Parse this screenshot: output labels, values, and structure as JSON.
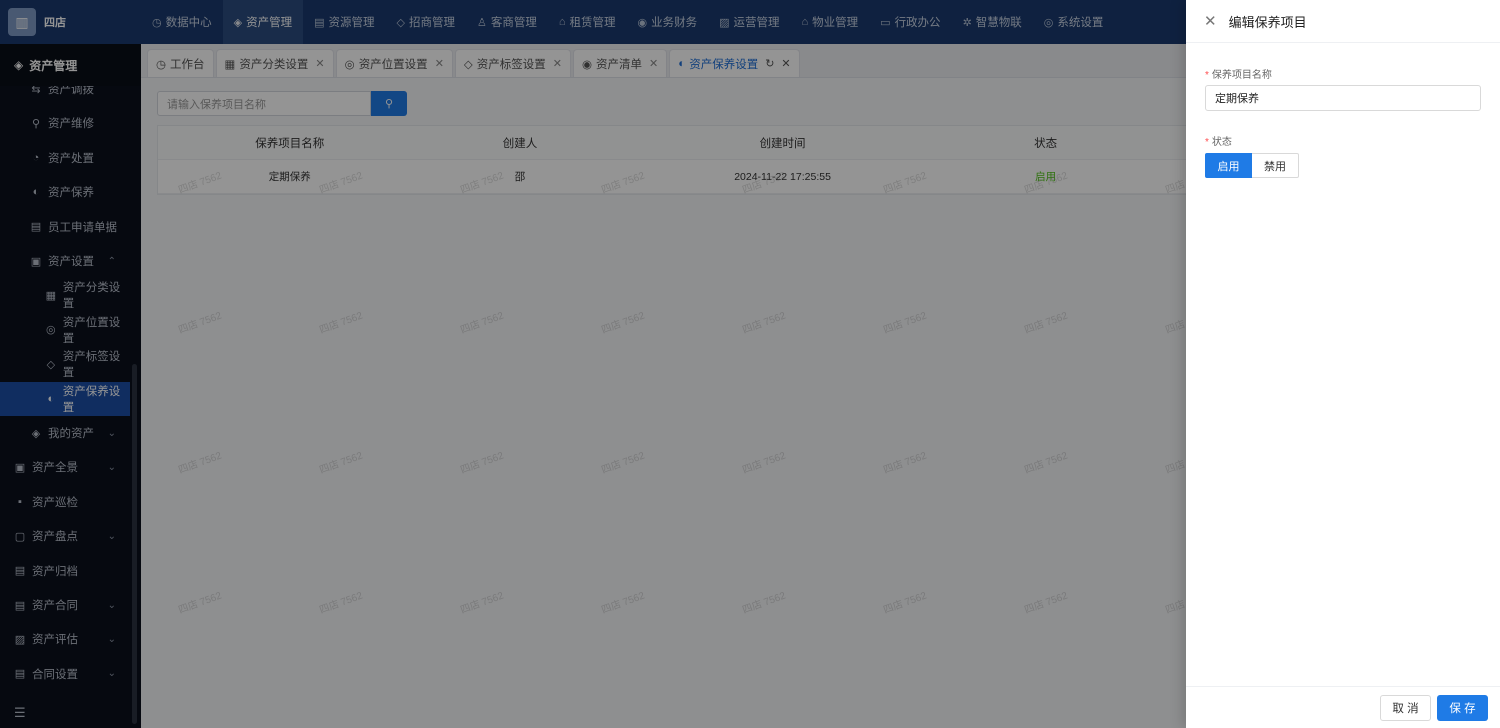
{
  "brand": {
    "name": "四店",
    "logo_icon": "building-icon"
  },
  "topnav": [
    {
      "label": "数据中心",
      "icon": "dashboard-icon",
      "glyph": "◷"
    },
    {
      "label": "资产管理",
      "icon": "cube-icon",
      "glyph": "◈",
      "active": true
    },
    {
      "label": "资源管理",
      "icon": "doc-icon",
      "glyph": "▤"
    },
    {
      "label": "招商管理",
      "icon": "tag-icon",
      "glyph": "◇"
    },
    {
      "label": "客商管理",
      "icon": "users-icon",
      "glyph": "♙"
    },
    {
      "label": "租赁管理",
      "icon": "home-icon",
      "glyph": "⌂"
    },
    {
      "label": "业务财务",
      "icon": "coin-icon",
      "glyph": "◉"
    },
    {
      "label": "运营管理",
      "icon": "chart-icon",
      "glyph": "▨"
    },
    {
      "label": "物业管理",
      "icon": "building-icon",
      "glyph": "⌂"
    },
    {
      "label": "行政办公",
      "icon": "monitor-icon",
      "glyph": "▭"
    },
    {
      "label": "智慧物联",
      "icon": "gear-icon",
      "glyph": "✲"
    },
    {
      "label": "系统设置",
      "icon": "settings-icon",
      "glyph": "◎"
    }
  ],
  "sidebar": {
    "header": "资产管理",
    "items": [
      {
        "label": "资产调拨",
        "glyph": "⇆",
        "icon": "transfer-icon",
        "level": 2
      },
      {
        "label": "资产维修",
        "glyph": "⚲",
        "icon": "wrench-icon",
        "level": 2
      },
      {
        "label": "资产处置",
        "glyph": "◔",
        "icon": "dispose-icon",
        "level": 2
      },
      {
        "label": "资产保养",
        "glyph": "◐",
        "icon": "maintenance-icon",
        "level": 2
      },
      {
        "label": "员工申请单据",
        "glyph": "▤",
        "icon": "form-icon",
        "level": 2
      },
      {
        "label": "资产设置",
        "glyph": "▣",
        "icon": "settings-folder-icon",
        "level": 2,
        "chev": "⌃"
      },
      {
        "label": "资产分类设置",
        "glyph": "▦",
        "icon": "category-icon",
        "level": 3
      },
      {
        "label": "资产位置设置",
        "glyph": "◎",
        "icon": "location-icon",
        "level": 3
      },
      {
        "label": "资产标签设置",
        "glyph": "◇",
        "icon": "tag-icon",
        "level": 3
      },
      {
        "label": "资产保养设置",
        "glyph": "◐",
        "icon": "maintenance-icon",
        "level": 3,
        "active": true
      },
      {
        "label": "我的资产",
        "glyph": "◈",
        "icon": "box-icon",
        "level": 2,
        "chev": "⌄"
      },
      {
        "label": "资产全景",
        "glyph": "▣",
        "icon": "panorama-icon",
        "level": 1,
        "chev": "⌄"
      },
      {
        "label": "资产巡检",
        "glyph": "▪",
        "icon": "inspect-icon",
        "level": 1
      },
      {
        "label": "资产盘点",
        "glyph": "▢",
        "icon": "inventory-icon",
        "level": 1,
        "chev": "⌄"
      },
      {
        "label": "资产归档",
        "glyph": "▤",
        "icon": "archive-icon",
        "level": 1
      },
      {
        "label": "资产合同",
        "glyph": "▤",
        "icon": "contract-icon",
        "level": 1,
        "chev": "⌄"
      },
      {
        "label": "资产评估",
        "glyph": "▨",
        "icon": "evaluate-icon",
        "level": 1,
        "chev": "⌄"
      },
      {
        "label": "合同设置",
        "glyph": "▤",
        "icon": "contract-settings-icon",
        "level": 1,
        "chev": "⌄"
      }
    ],
    "footer_glyph": "☰"
  },
  "tabs": [
    {
      "label": "工作台",
      "glyph": "◷",
      "icon": "dashboard-icon",
      "closable": false
    },
    {
      "label": "资产分类设置",
      "glyph": "▦",
      "icon": "category-icon",
      "closable": true
    },
    {
      "label": "资产位置设置",
      "glyph": "◎",
      "icon": "location-icon",
      "closable": true
    },
    {
      "label": "资产标签设置",
      "glyph": "◇",
      "icon": "tag-icon",
      "closable": true
    },
    {
      "label": "资产清单",
      "glyph": "◉",
      "icon": "list-icon",
      "closable": true
    },
    {
      "label": "资产保养设置",
      "glyph": "◐",
      "icon": "maintenance-icon",
      "closable": true,
      "active": true,
      "refresh": "↻"
    }
  ],
  "search": {
    "placeholder": "请输入保养项目名称",
    "button_glyph": "⚲"
  },
  "table": {
    "headers": [
      "保养项目名称",
      "创建人",
      "创建时间",
      "状态",
      ""
    ],
    "rows": [
      {
        "name": "定期保养",
        "creator": "邵",
        "created_at": "2024-11-22 17:25:55",
        "status": "启用"
      }
    ]
  },
  "watermark_text": "四店 7562",
  "drawer": {
    "title": "编辑保养项目",
    "close_glyph": "✕",
    "name_label": "保养项目名称",
    "name_value": "定期保养",
    "status_label": "状态",
    "status_options": [
      "启用",
      "禁用"
    ],
    "status_selected": "启用",
    "required_mark": "*",
    "cancel_label": "取 消",
    "save_label": "保 存"
  },
  "colors": {
    "primary": "#1f7be6",
    "topbar": "#1a3a6e",
    "sidebar": "#0c111d",
    "status_on": "#52c41a"
  }
}
